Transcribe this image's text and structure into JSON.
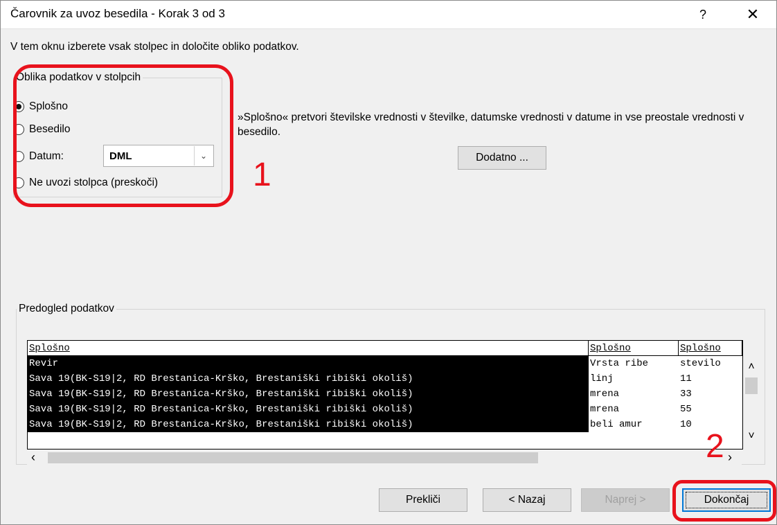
{
  "window": {
    "title": "Čarovnik za uvoz besedila - Korak 3 od 3",
    "help_label": "?",
    "close_label": "✕"
  },
  "intro_text": "V tem oknu izberete vsak stolpec in določite obliko podatkov.",
  "format_group": {
    "legend": "Oblika podatkov v stolpcih",
    "options": [
      {
        "label": "Splošno",
        "selected": true
      },
      {
        "label": "Besedilo",
        "selected": false
      },
      {
        "label": "Datum:",
        "selected": false
      },
      {
        "label": "Ne uvozi stolpca (preskoči)",
        "selected": false
      }
    ],
    "date_format": "DML"
  },
  "description": "»Splošno« pretvori številske vrednosti v številke, datumske vrednosti v datume in vse preostale vrednosti v besedilo.",
  "advanced_button": "Dodatno ...",
  "annotations": {
    "one": "1",
    "two": "2",
    "color": "#e8121c"
  },
  "preview": {
    "legend": "Predogled podatkov",
    "headers": [
      "Splošno",
      "Splošno",
      "Splošno"
    ],
    "rows": [
      [
        "Revir",
        "Vrsta ribe",
        "stevilo"
      ],
      [
        "Sava 19(BK-S19|2, RD Brestanica-Krško, Brestaniški ribiški okoliš)",
        "linj",
        "11"
      ],
      [
        "Sava 19(BK-S19|2, RD Brestanica-Krško, Brestaniški ribiški okoliš)",
        "mrena",
        "33"
      ],
      [
        "Sava 19(BK-S19|2, RD Brestanica-Krško, Brestaniški ribiški okoliš)",
        "mrena",
        "55"
      ],
      [
        "Sava 19(BK-S19|2, RD Brestanica-Krško, Brestaniški ribiški okoliš)",
        "beli amur",
        "10"
      ]
    ]
  },
  "buttons": {
    "cancel": "Prekliči",
    "back": "< Nazaj",
    "next": "Naprej >",
    "finish": "Dokončaj"
  }
}
